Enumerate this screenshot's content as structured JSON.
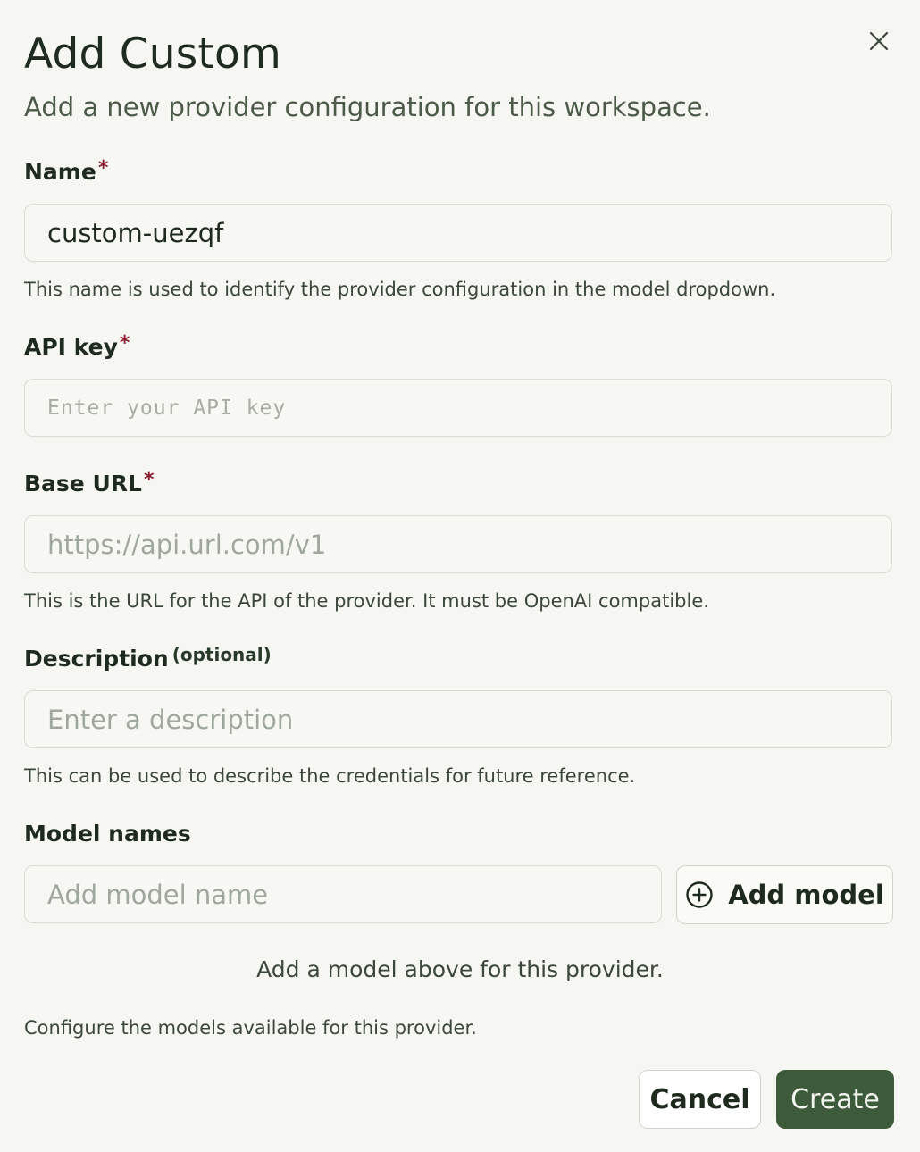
{
  "dialog": {
    "title": "Add Custom",
    "subtitle": "Add a new provider configuration for this workspace.",
    "close_icon": "close-icon"
  },
  "fields": {
    "name": {
      "label": "Name",
      "required_mark": "*",
      "value": "custom-uezqf",
      "help": "This name is used to identify the provider configuration in the model dropdown."
    },
    "api_key": {
      "label": "API key",
      "required_mark": "*",
      "placeholder": "Enter your API key"
    },
    "base_url": {
      "label": "Base URL",
      "required_mark": "*",
      "placeholder": "https://api.url.com/v1",
      "help": "This is the URL for the API of the provider. It must be OpenAI compatible."
    },
    "description": {
      "label": "Description",
      "optional_tag": "(optional)",
      "placeholder": "Enter a description",
      "help": "This can be used to describe the credentials for future reference."
    },
    "model_names": {
      "label": "Model names",
      "placeholder": "Add model name",
      "add_button_label": "Add model",
      "add_icon": "plus-circle-icon",
      "empty_message": "Add a model above for this provider.",
      "help": "Configure the models available for this provider."
    }
  },
  "footer": {
    "cancel_label": "Cancel",
    "create_label": "Create"
  },
  "colors": {
    "background": "#f6f7f2",
    "primary": "#3d5b3a",
    "required": "#8a1c2e"
  }
}
